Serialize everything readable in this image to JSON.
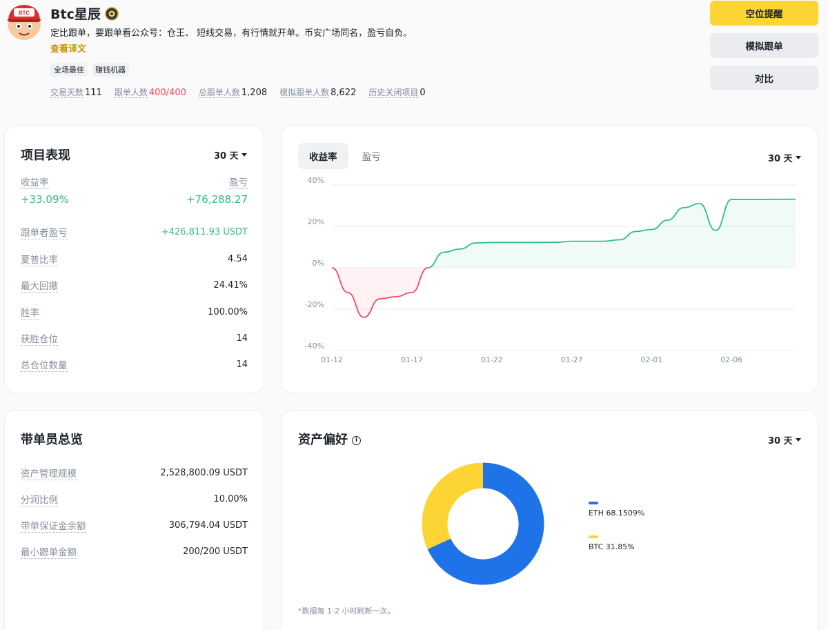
{
  "profile": {
    "name": "Btc星辰",
    "avatar_text": "BTC",
    "bio": "定比跟单，要跟单看公众号：仓王、 短线交易，有行情就开单。币安广场同名，盈亏自负。",
    "translate_label": "查看译文",
    "tags": [
      "全场最佳",
      "赚钱机器"
    ],
    "stats": [
      {
        "label": "交易天数",
        "value": "111"
      },
      {
        "label": "跟单人数",
        "value": "400/400"
      },
      {
        "label": "总跟单人数",
        "value": "1,208"
      },
      {
        "label": "模拟跟单人数",
        "value": "8,622"
      },
      {
        "label": "历史关闭项目",
        "value": "0"
      }
    ]
  },
  "actions": {
    "alert": "空位提醒",
    "mock_copy": "模拟跟单",
    "compare": "对比"
  },
  "performance": {
    "title": "项目表现",
    "period": "30 天",
    "roi_label": "收益率",
    "pnl_label": "盈亏",
    "roi_value": "+33.09%",
    "pnl_value": "+76,288.27",
    "rows": [
      {
        "label": "跟单者盈亏",
        "value": "+426,811.93 USDT"
      },
      {
        "label": "夏普比率",
        "value": "4.54"
      },
      {
        "label": "最大回撤",
        "value": "24.41%"
      },
      {
        "label": "胜率",
        "value": "100.00%"
      },
      {
        "label": "获胜仓位",
        "value": "14"
      },
      {
        "label": "总仓位数量",
        "value": "14"
      }
    ]
  },
  "chart_panel": {
    "tabs": [
      "收益率",
      "盈亏"
    ],
    "period": "30 天"
  },
  "chart_data": {
    "type": "line",
    "ylim": [
      -40,
      40
    ],
    "yticks": [
      40,
      20,
      0,
      -20,
      -40
    ],
    "ytick_labels": [
      "40%",
      "20%",
      "0%",
      "-20%",
      "-40%"
    ],
    "xtick_labels": [
      "01-12",
      "01-17",
      "01-22",
      "01-27",
      "02-01",
      "02-06"
    ],
    "x_start": "01-12",
    "x_end": "02-10",
    "series": [
      {
        "values": [
          {
            "x": "01-12",
            "y": 0
          },
          {
            "x": "01-13",
            "y": -12
          },
          {
            "x": "01-14",
            "y": -24
          },
          {
            "x": "01-15",
            "y": -15
          },
          {
            "x": "01-16",
            "y": -14
          },
          {
            "x": "01-17",
            "y": -12
          },
          {
            "x": "01-18",
            "y": 0
          },
          {
            "x": "01-19",
            "y": 7.5
          },
          {
            "x": "01-20",
            "y": 9
          },
          {
            "x": "01-21",
            "y": 12
          },
          {
            "x": "01-22",
            "y": 12.2
          },
          {
            "x": "01-24",
            "y": 12.2
          },
          {
            "x": "01-26",
            "y": 12.3
          },
          {
            "x": "01-27",
            "y": 12.8
          },
          {
            "x": "01-29",
            "y": 12.8
          },
          {
            "x": "01-30",
            "y": 13.5
          },
          {
            "x": "01-31",
            "y": 17.5
          },
          {
            "x": "02-01",
            "y": 18.5
          },
          {
            "x": "02-02",
            "y": 23
          },
          {
            "x": "02-03",
            "y": 29
          },
          {
            "x": "02-04",
            "y": 31
          },
          {
            "x": "02-05",
            "y": 18
          },
          {
            "x": "02-06",
            "y": 33
          },
          {
            "x": "02-08",
            "y": 33
          },
          {
            "x": "02-10",
            "y": 33.09
          }
        ]
      }
    ],
    "colors": {
      "positive": "#2ebd85",
      "negative": "#f6465d"
    }
  },
  "overview": {
    "title": "带单员总览",
    "rows": [
      {
        "label": "资产管理规模",
        "value": "2,528,800.09 USDT"
      },
      {
        "label": "分润比例",
        "value": "10.00%"
      },
      {
        "label": "带单保证金余额",
        "value": "306,794.04 USDT"
      },
      {
        "label": "最小跟单金额",
        "value": "200/200 USDT"
      }
    ]
  },
  "assets": {
    "title": "资产偏好",
    "period": "30 天",
    "note": "*数据每 1-2 小时刷新一次。",
    "legend": [
      {
        "label": "ETH 68.1509%",
        "color": "#1e73e8"
      },
      {
        "label": "BTC 31.85%",
        "color": "#fcd535"
      }
    ],
    "donut": [
      {
        "name": "ETH",
        "value": 68.1509,
        "color": "#1e73e8"
      },
      {
        "name": "BTC",
        "value": 31.85,
        "color": "#fcd535"
      }
    ]
  }
}
